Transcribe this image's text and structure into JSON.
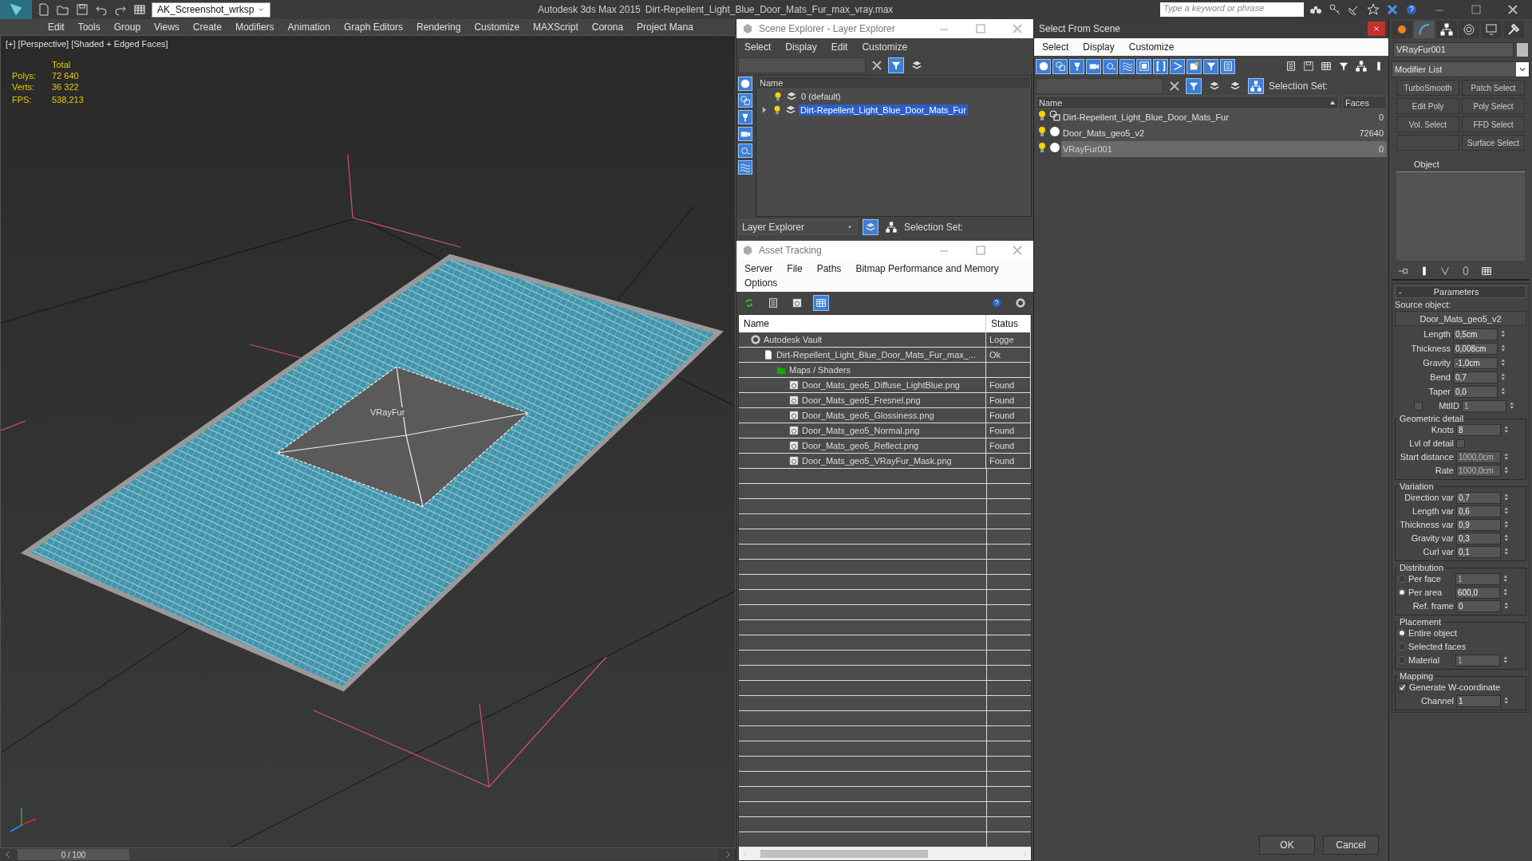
{
  "title_bar": {
    "workspace": "AK_Screenshot_wrksp",
    "app": "Autodesk 3ds Max  2015",
    "file": "Dirt-Repellent_Light_Blue_Door_Mats_Fur_max_vray.max",
    "search_placeholder": "Type a keyword or phrase"
  },
  "menu": [
    "Edit",
    "Tools",
    "Group",
    "Views",
    "Create",
    "Modifiers",
    "Animation",
    "Graph Editors",
    "Rendering",
    "Customize",
    "MAXScript",
    "Corona",
    "Project Mana"
  ],
  "viewport": {
    "label": "[+] [Perspective] [Shaded + Edged Faces]",
    "stats_header": "Total",
    "stats": [
      {
        "label": "Polys:",
        "value": "72 640"
      },
      {
        "label": "Verts:",
        "value": "36 322"
      }
    ],
    "fps": {
      "label": "FPS:",
      "value": "538,213"
    },
    "object_label": "VRayFur"
  },
  "timeline": {
    "frame": "0 / 100",
    "level": 0
  },
  "scene_explorer": {
    "title": "Scene Explorer - Layer Explorer",
    "menu": [
      "Select",
      "Display",
      "Edit",
      "Customize"
    ],
    "column": "Name",
    "layers": [
      {
        "name": "0 (default)",
        "selected": false
      },
      {
        "name": "Dirt-Repellent_Light_Blue_Door_Mats_Fur",
        "selected": true,
        "expanded": false
      }
    ],
    "explorer": "Layer Explorer",
    "selection_set": "Selection Set:"
  },
  "asset_tracking": {
    "title": "Asset Tracking",
    "menu": [
      "Server",
      "File",
      "Paths",
      "Bitmap Performance and Memory",
      "Options"
    ],
    "columns": [
      "Name",
      "Status"
    ],
    "rows": [
      {
        "kind": "vault",
        "name": "Autodesk Vault",
        "status": "Logge",
        "children": [
          {
            "kind": "max_file",
            "name": "Dirt-Repellent_Light_Blue_Door_Mats_Fur_max_...",
            "status": "Ok",
            "children": [
              {
                "kind": "maps",
                "name": "Maps / Shaders",
                "children": [
                  {
                    "kind": "bitmap",
                    "name": "Door_Mats_geo5_Diffuse_LightBlue.png",
                    "status": "Found"
                  },
                  {
                    "kind": "bitmap",
                    "name": "Door_Mats_geo5_Fresnel.png",
                    "status": "Found"
                  },
                  {
                    "kind": "bitmap",
                    "name": "Door_Mats_geo5_Glossiness.png",
                    "status": "Found"
                  },
                  {
                    "kind": "bitmap",
                    "name": "Door_Mats_geo5_Normal.png",
                    "status": "Found"
                  },
                  {
                    "kind": "bitmap",
                    "name": "Door_Mats_geo5_Reflect.png",
                    "status": "Found"
                  },
                  {
                    "kind": "bitmap",
                    "name": "Door_Mats_geo5_VRayFur_Mask.png",
                    "status": "Found"
                  }
                ]
              }
            ]
          }
        ]
      }
    ]
  },
  "select_from_scene": {
    "title": "Select From Scene",
    "menu": [
      "Select",
      "Display",
      "Customize"
    ],
    "selection_set": "Selection Set:",
    "columns": [
      "Name",
      "Faces"
    ],
    "rows": [
      {
        "kind": "group",
        "name": "Dirt-Repellent_Light_Blue_Door_Mats_Fur",
        "faces": "0",
        "selected": false
      },
      {
        "kind": "geometry",
        "name": "Door_Mats_geo5_v2",
        "faces": "72640",
        "selected": false
      },
      {
        "kind": "geometry",
        "name": "VRayFur001",
        "faces": "0",
        "selected": true
      }
    ],
    "buttons": [
      "OK",
      "Cancel"
    ]
  },
  "command_panel": {
    "object_name": "VRayFur001",
    "modifier_list": "Modifier List",
    "modifier_buttons": [
      {
        "left": "TurboSmooth",
        "right": "Patch Select"
      },
      {
        "left": "Edit Poly",
        "right": "Poly Select"
      },
      {
        "left": "Vol. Select",
        "right": "FFD Select"
      },
      {
        "right": "Surface Select"
      }
    ],
    "stack_title": "Object",
    "rollout_sign": "-",
    "rollout_title": "Parameters",
    "source_label": "Source object:",
    "source_object": "Door_Mats_geo5_v2",
    "params": [
      {
        "kind": "spinner",
        "label": "Length",
        "value": "0,5cm",
        "disabled": false
      },
      {
        "kind": "spinner",
        "label": "Thickness",
        "value": "0,008cm",
        "disabled": false
      },
      {
        "kind": "spinner",
        "label": "Gravity",
        "value": "-1,0cm",
        "disabled": false
      },
      {
        "kind": "spinner",
        "label": "Bend",
        "value": "0,7",
        "disabled": false
      },
      {
        "kind": "spinner",
        "label": "Taper",
        "value": "0,0",
        "disabled": false
      },
      {
        "kind": "check_spinner",
        "label": "MtlID",
        "checked": false,
        "value": "1",
        "disabled": true
      }
    ],
    "groups": [
      {
        "title": "Geometric detail",
        "rows": [
          {
            "kind": "spinner",
            "label": "Knots",
            "value": "8",
            "disabled": false
          },
          {
            "kind": "toggle",
            "label": "Lvl of detail",
            "checked": false
          },
          {
            "kind": "spinner",
            "label": "Start distance",
            "value": "1000,0cm",
            "disabled": true
          },
          {
            "kind": "spinner",
            "label": "Rate",
            "value": "1000,0cm",
            "disabled": true
          }
        ]
      },
      {
        "title": "Variation",
        "rows": [
          {
            "kind": "spinner",
            "label": "Direction var",
            "value": "0,7",
            "disabled": false
          },
          {
            "kind": "spinner",
            "label": "Length var",
            "value": "0,6",
            "disabled": false
          },
          {
            "kind": "spinner",
            "label": "Thickness var",
            "value": "0,9",
            "disabled": false
          },
          {
            "kind": "spinner",
            "label": "Gravity var",
            "value": "0,3",
            "disabled": false
          },
          {
            "kind": "spinner",
            "label": "Curl var",
            "value": "0,1",
            "disabled": false
          }
        ]
      },
      {
        "title": "Distribution",
        "rows": [
          {
            "kind": "radio",
            "label": "Per face",
            "selected": false,
            "value": "1",
            "disabled": true
          },
          {
            "kind": "radio",
            "label": "Per area",
            "selected": true,
            "value": "600,0",
            "disabled": false
          },
          {
            "kind": "spinner",
            "label": "Ref. frame",
            "value": "0",
            "disabled": false
          }
        ]
      },
      {
        "title": "Placement",
        "rows": [
          {
            "kind": "radio",
            "label": "Entire object",
            "selected": true
          },
          {
            "kind": "radio",
            "label": "Selected faces",
            "selected": false
          },
          {
            "kind": "radio",
            "label": "Material",
            "selected": false,
            "value": "1",
            "disabled": true
          }
        ]
      },
      {
        "title": "Mapping",
        "rows": [
          {
            "kind": "checkbox",
            "label": "Generate W-coordinate",
            "checked": true
          },
          {
            "kind": "spinner",
            "label": "Channel",
            "value": "1",
            "disabled": false
          }
        ]
      }
    ]
  }
}
